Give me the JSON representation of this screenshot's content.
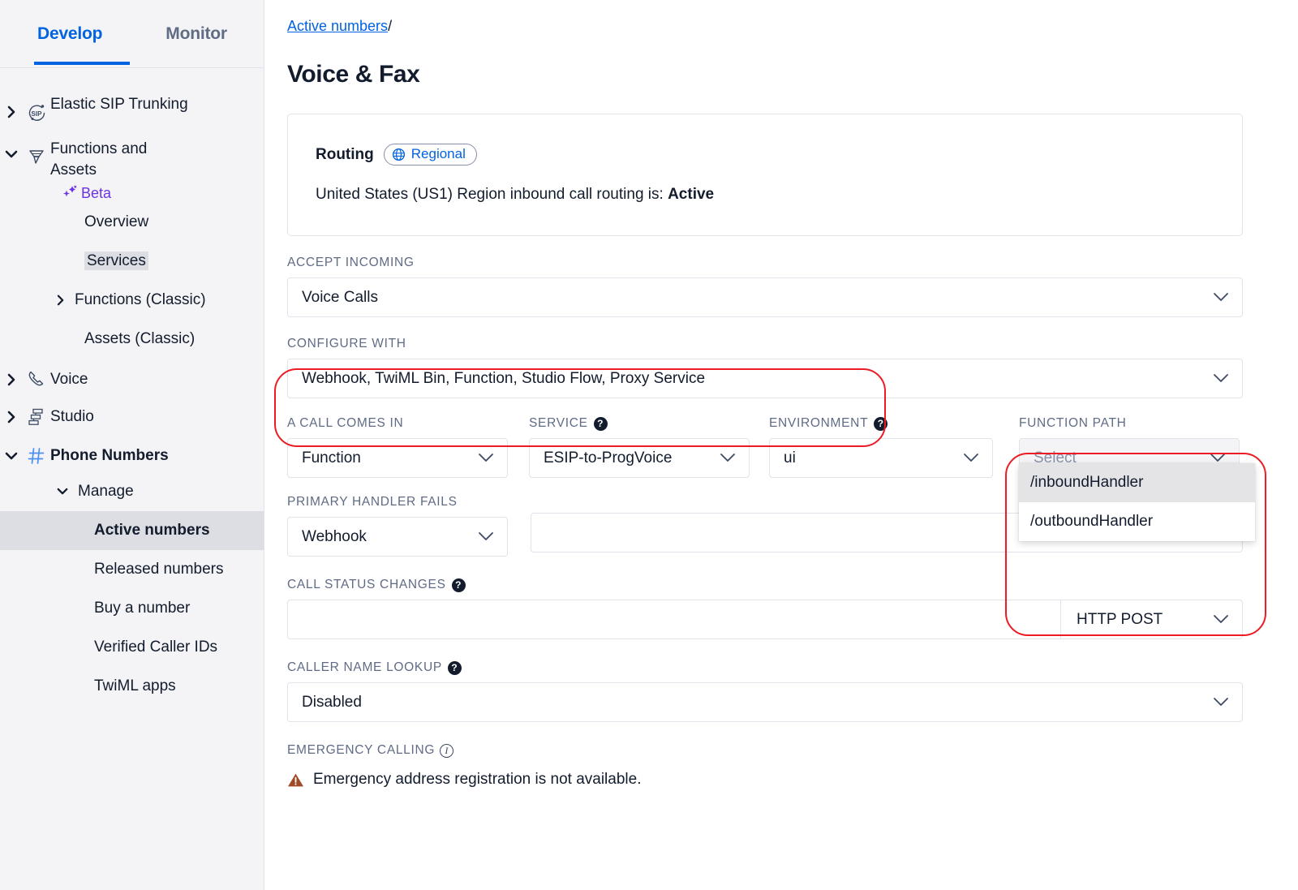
{
  "sidebar": {
    "tabs": [
      {
        "label": "Develop",
        "active": true
      },
      {
        "label": "Monitor",
        "active": false
      }
    ],
    "items": [
      {
        "label": "Elastic SIP Trunking",
        "icon": "sip-icon",
        "caret": "right"
      },
      {
        "label": "Functions and Assets",
        "icon": "functions-icon",
        "caret": "down"
      },
      {
        "label": "Beta",
        "icon": "sparkle-icon"
      },
      {
        "label": "Overview"
      },
      {
        "label": "Services",
        "highlighted": true
      },
      {
        "label": "Functions (Classic)",
        "caret": "right"
      },
      {
        "label": "Assets (Classic)"
      },
      {
        "label": "Voice",
        "icon": "phone-icon",
        "caret": "right"
      },
      {
        "label": "Studio",
        "icon": "studio-icon",
        "caret": "right"
      },
      {
        "label": "Phone Numbers",
        "icon": "hash-icon",
        "caret": "down",
        "bold": true
      },
      {
        "label": "Manage",
        "caret": "down"
      },
      {
        "label": "Active numbers",
        "selected": true
      },
      {
        "label": "Released numbers"
      },
      {
        "label": "Buy a number"
      },
      {
        "label": "Verified Caller IDs"
      },
      {
        "label": "TwiML apps"
      }
    ]
  },
  "breadcrumb": {
    "link": "Active numbers",
    "separator": "/"
  },
  "page": {
    "title": "Voice & Fax"
  },
  "routing": {
    "label": "Routing",
    "badge": "Regional",
    "description_prefix": "United States (US1) Region inbound call routing is: ",
    "status": "Active"
  },
  "form": {
    "accept_incoming": {
      "label": "Accept incoming",
      "value": "Voice Calls"
    },
    "configure_with": {
      "label": "Configure with",
      "value": "Webhook, TwiML Bin, Function, Studio Flow, Proxy Service"
    },
    "a_call_comes_in": {
      "label": "A call comes in",
      "value": "Function"
    },
    "service": {
      "label": "Service",
      "value": "ESIP-to-ProgVoice",
      "help": "?"
    },
    "environment": {
      "label": "Environment",
      "value": "ui",
      "help": "?"
    },
    "function_path": {
      "label": "Function path",
      "placeholder": "Select",
      "options": [
        {
          "label": "/inboundHandler",
          "active": true
        },
        {
          "label": "/outboundHandler",
          "active": false
        }
      ]
    },
    "primary_handler_fails": {
      "label": "Primary handler fails",
      "value": "Webhook",
      "url_value": ""
    },
    "call_status_changes": {
      "label": "Call status changes",
      "value": "",
      "method": "HTTP POST",
      "help": "?"
    },
    "caller_name_lookup": {
      "label": "Caller name lookup",
      "value": "Disabled",
      "help": "?"
    },
    "emergency_calling": {
      "label": "Emergency calling",
      "info": "i",
      "warning": "Emergency address registration is not available."
    }
  },
  "colors": {
    "accent_blue": "#0263E0",
    "beta_purple": "#6C32E3",
    "annotation_red": "#ED1C24",
    "warning_brown": "#A14A28",
    "sidebar_bg": "#F4F4F6",
    "selected_bg": "#DCDEE3"
  }
}
